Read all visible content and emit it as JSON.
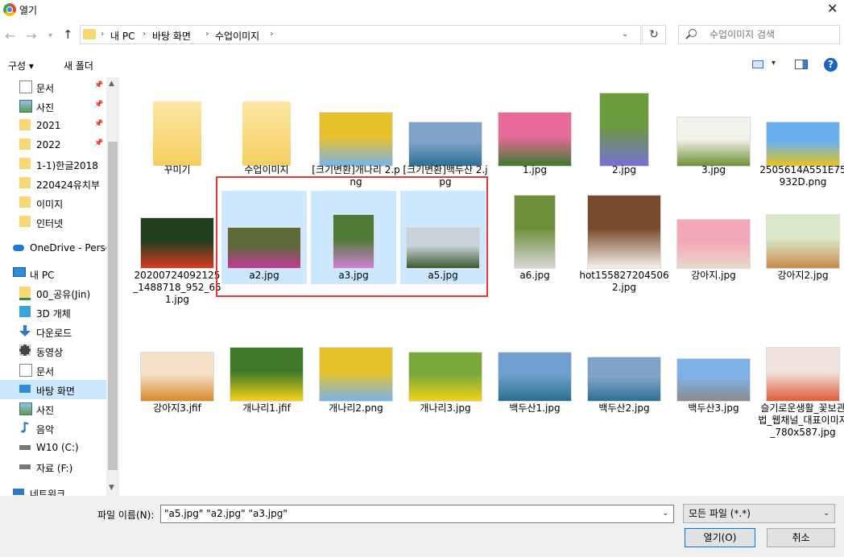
{
  "window": {
    "title": "열기"
  },
  "address": {
    "crumbs": [
      "내 PC",
      "바탕 화면",
      "수업이미지"
    ],
    "search_placeholder": "수업이미지 검색"
  },
  "toolbar": {
    "organize_label": "구성 ▾",
    "new_folder_label": "새 폴더"
  },
  "sidebar": {
    "items": [
      {
        "label": "문서",
        "icon": "document-icon",
        "pinned": true
      },
      {
        "label": "사진",
        "icon": "pictures-icon",
        "pinned": true
      },
      {
        "label": "2021",
        "icon": "folder-icon",
        "pinned": true
      },
      {
        "label": "2022",
        "icon": "folder-icon",
        "pinned": true
      },
      {
        "label": "1-1)한글2018",
        "icon": "folder-icon"
      },
      {
        "label": "220424유치부",
        "icon": "folder-icon"
      },
      {
        "label": "이미지",
        "icon": "folder-icon"
      },
      {
        "label": "인터넷",
        "icon": "folder-icon"
      },
      {
        "label": "OneDrive - Person",
        "icon": "onedrive-icon"
      },
      {
        "label": "내 PC",
        "icon": "pc-icon"
      },
      {
        "label": "00_공유(Jin)",
        "icon": "shared-icon"
      },
      {
        "label": "3D 개체",
        "icon": "3d-icon"
      },
      {
        "label": "다운로드",
        "icon": "download-icon"
      },
      {
        "label": "동영상",
        "icon": "video-icon"
      },
      {
        "label": "문서",
        "icon": "document-icon"
      },
      {
        "label": "바탕 화면",
        "icon": "desktop-icon",
        "selected": true
      },
      {
        "label": "사진",
        "icon": "pictures-icon"
      },
      {
        "label": "음악",
        "icon": "music-icon"
      },
      {
        "label": "W10 (C:)",
        "icon": "drive-icon"
      },
      {
        "label": "자료 (F:)",
        "icon": "drive-icon"
      },
      {
        "label": "네트워크",
        "icon": "network-icon"
      }
    ]
  },
  "files": [
    {
      "name": "꾸미기",
      "type": "folder"
    },
    {
      "name": "수업이미지",
      "type": "folder"
    },
    {
      "name": "[크기변환]개나리 2.png",
      "type": "image",
      "colors": [
        "#e8c22a",
        "#7cb3e8"
      ]
    },
    {
      "name": "[크기변환]백두산 2.jpg",
      "type": "image",
      "colors": [
        "#7fa4c8",
        "#2f6f93"
      ]
    },
    {
      "name": "1.jpg",
      "type": "image",
      "colors": [
        "#e86a9a",
        "#3f7a2e"
      ]
    },
    {
      "name": "2.jpg",
      "type": "image",
      "colors": [
        "#6a9b3c",
        "#7a6fd6"
      ]
    },
    {
      "name": "3.jpg",
      "type": "image",
      "colors": [
        "#f2f2ea",
        "#6f8f3a"
      ]
    },
    {
      "name": "2505614A551E75932D.png",
      "type": "image",
      "colors": [
        "#6ab0ee",
        "#e8c31d"
      ]
    },
    {
      "name": "20200724092125_1488718_952_651.jpg",
      "type": "image",
      "colors": [
        "#1f3f1c",
        "#d93a22"
      ]
    },
    {
      "name": "a2.jpg",
      "type": "image",
      "selected": true,
      "colors": [
        "#5d6a3a",
        "#c43a9a"
      ]
    },
    {
      "name": "a3.jpg",
      "type": "image",
      "selected": true,
      "colors": [
        "#4f7a35",
        "#d07fd6"
      ]
    },
    {
      "name": "a5.jpg",
      "type": "image",
      "selected": true,
      "colors": [
        "#c8d2d8",
        "#3b5a2e"
      ]
    },
    {
      "name": "a6.jpg",
      "type": "image",
      "colors": [
        "#6e8f3a",
        "#d8d8d8"
      ]
    },
    {
      "name": "hot1558272045062.jpg",
      "type": "image",
      "colors": [
        "#7a4a2c",
        "#f4f1ea"
      ]
    },
    {
      "name": "강아지.jpg",
      "type": "image",
      "colors": [
        "#f3a8b8",
        "#e8d8c8"
      ]
    },
    {
      "name": "강아지2.jpg",
      "type": "image",
      "colors": [
        "#d8e8c8",
        "#c88a4a"
      ]
    },
    {
      "name": "강아지3.jfif",
      "type": "image",
      "colors": [
        "#f6e0c8",
        "#d8882a"
      ]
    },
    {
      "name": "개나리1.jfif",
      "type": "image",
      "colors": [
        "#3f7a2a",
        "#f2d21a"
      ]
    },
    {
      "name": "개나리2.png",
      "type": "image",
      "colors": [
        "#e8c22a",
        "#7cb3e8"
      ]
    },
    {
      "name": "개나리3.jpg",
      "type": "image",
      "colors": [
        "#7aa83a",
        "#f2d21a"
      ]
    },
    {
      "name": "백두산1.jpg",
      "type": "image",
      "colors": [
        "#6fa0d0",
        "#2a6f8a"
      ]
    },
    {
      "name": "백두산2.jpg",
      "type": "image",
      "colors": [
        "#7fa4c8",
        "#2f6f93"
      ]
    },
    {
      "name": "백두산3.jpg",
      "type": "image",
      "colors": [
        "#7fb0e6",
        "#8a8a8a"
      ]
    },
    {
      "name": "슬기로운생활_꽃보관법_웹채널_대표이미지_780x587.jpg",
      "type": "image",
      "colors": [
        "#f1e4de",
        "#e05a3a"
      ]
    }
  ],
  "bottom": {
    "filename_label": "파일 이름(N):",
    "filename_value": "\"a5.jpg\" \"a2.jpg\" \"a3.jpg\"",
    "filetype_value": "모든 파일 (*.*)",
    "open_label": "열기(O)",
    "cancel_label": "취소"
  }
}
